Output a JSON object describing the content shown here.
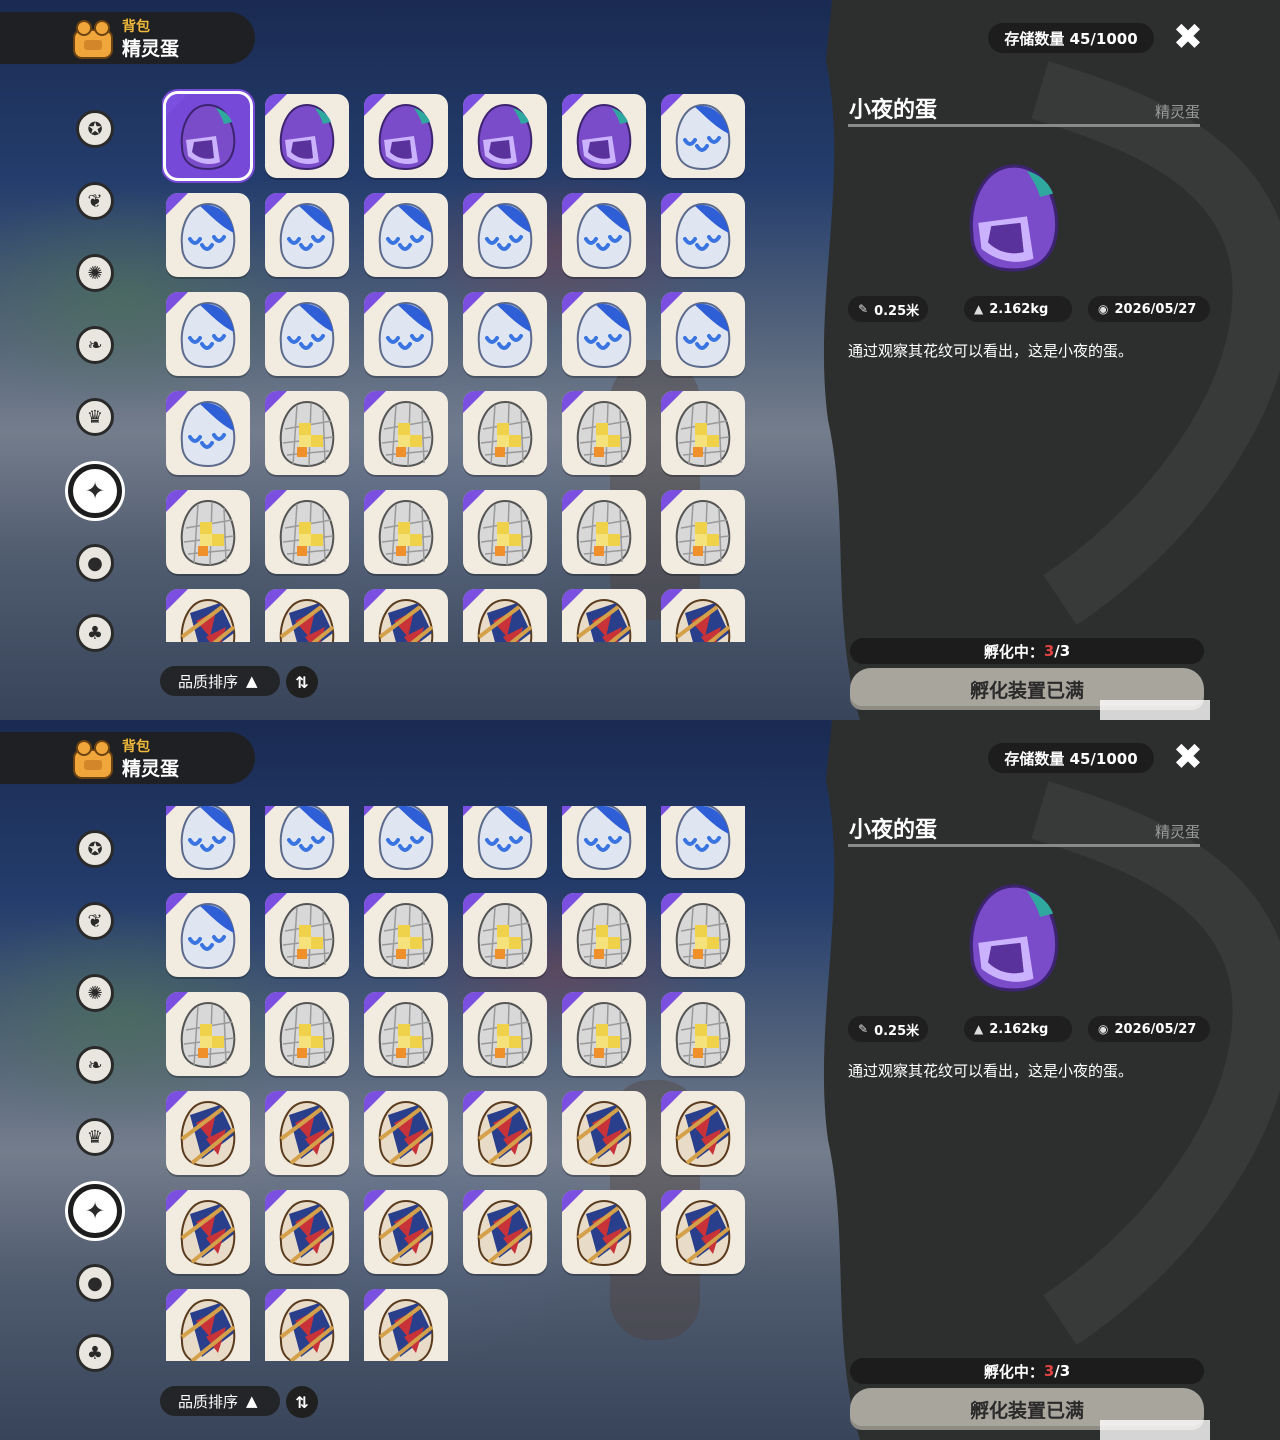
{
  "header": {
    "subtitle": "背包",
    "title": "精灵蛋"
  },
  "nav": [
    "star-badge-icon",
    "leaf-icon",
    "sparkle-badge-icon",
    "leaves-icon",
    "crown-card-icon",
    "egg-category-icon",
    "acorn-icon",
    "sofa-icon"
  ],
  "storage_label": "存储数量 45/1000",
  "close_icon": "close-icon",
  "item": {
    "name": "小夜的蛋",
    "category": "精灵蛋",
    "size": "0.25米",
    "weight": "2.162kg",
    "date": "2026/05/27",
    "description": "通过观察其花纹可以看出，这是小夜的蛋。"
  },
  "hatching": {
    "label": "孵化中：",
    "current": "3",
    "total": "/3"
  },
  "hatch_button": "孵化装置已满",
  "sort": {
    "label": "品质排序",
    "toggle": "⇅"
  },
  "colors": {
    "accent": "#7649d8",
    "hatch_current": "#e04242"
  },
  "panels": [
    {
      "rows": [
        [
          "purple",
          "purple",
          "purple",
          "purple",
          "purple",
          "blue"
        ],
        [
          "blue",
          "blue",
          "blue",
          "blue",
          "blue",
          "blue"
        ],
        [
          "blue",
          "blue",
          "blue",
          "blue",
          "blue",
          "blue"
        ],
        [
          "blue",
          "yellow",
          "yellow",
          "yellow",
          "yellow",
          "yellow"
        ],
        [
          "yellow",
          "yellow",
          "yellow",
          "yellow",
          "yellow",
          "yellow"
        ],
        [
          "red",
          "red",
          "red",
          "red",
          "red",
          "red"
        ]
      ],
      "selected_index": 0
    },
    {
      "rows": [
        [
          "blue",
          "blue",
          "blue",
          "blue",
          "blue",
          "blue"
        ],
        [
          "blue",
          "yellow",
          "yellow",
          "yellow",
          "yellow",
          "yellow"
        ],
        [
          "yellow",
          "yellow",
          "yellow",
          "yellow",
          "yellow",
          "yellow"
        ],
        [
          "red",
          "red",
          "red",
          "red",
          "red",
          "red"
        ],
        [
          "red",
          "red",
          "red",
          "red",
          "red",
          "red"
        ],
        [
          "red",
          "red",
          "red"
        ]
      ],
      "selected_index": -1
    }
  ]
}
